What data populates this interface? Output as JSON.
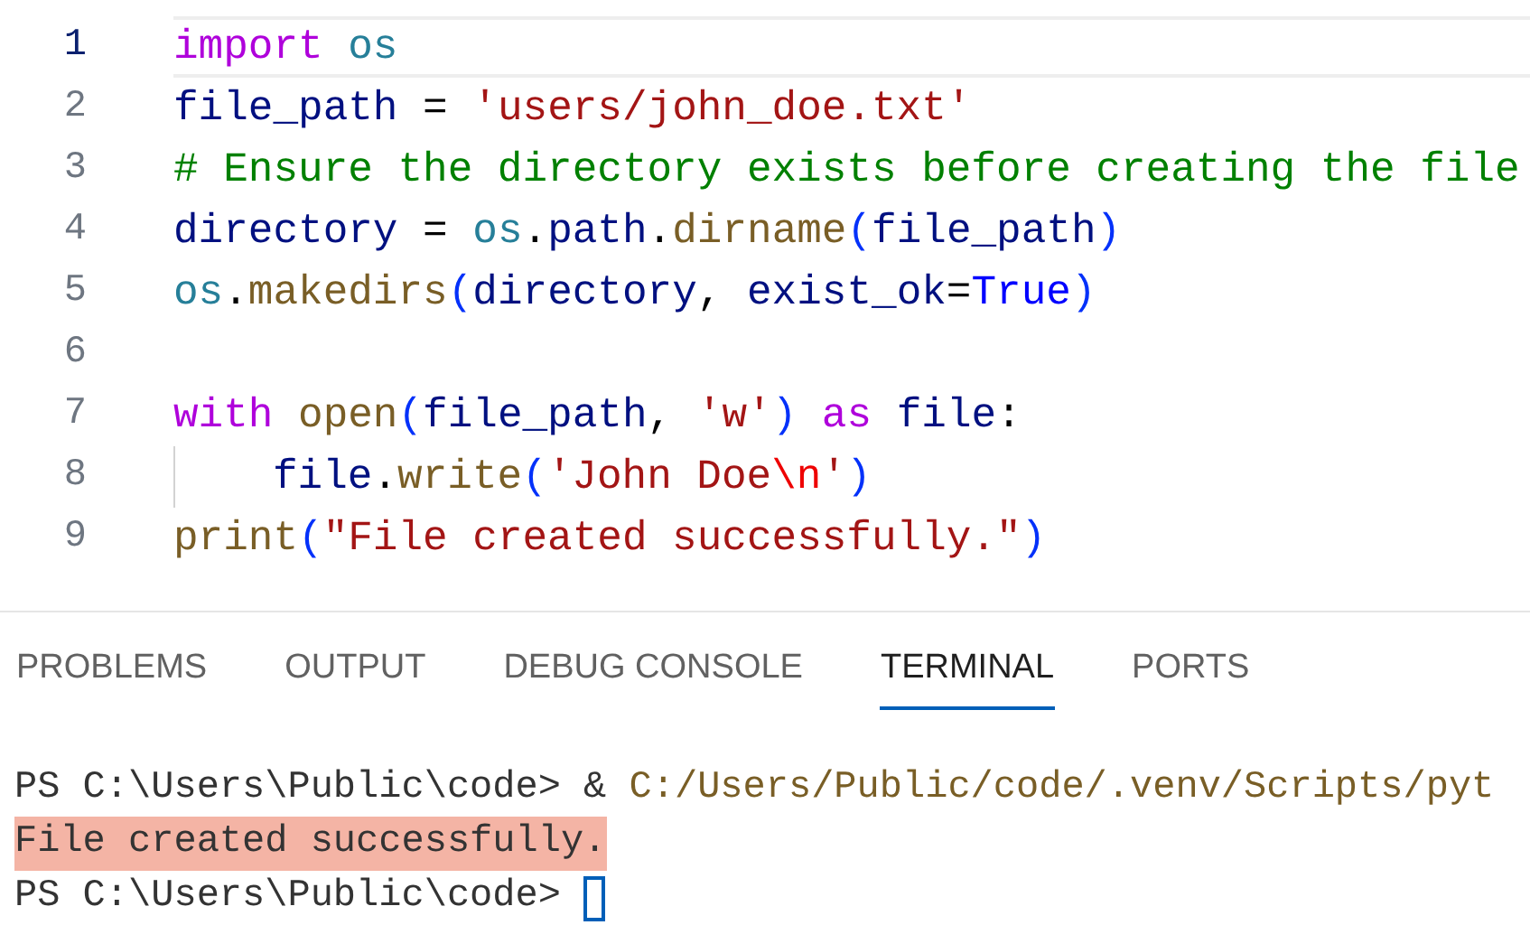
{
  "editor": {
    "lines": [
      {
        "number": "1",
        "current": true,
        "tokens": [
          {
            "kind": "keyword",
            "text": "import "
          },
          {
            "kind": "module",
            "text": "os"
          }
        ]
      },
      {
        "number": "2",
        "current": false,
        "tokens": [
          {
            "kind": "variable",
            "text": "file_path"
          },
          {
            "kind": "plain",
            "text": " = "
          },
          {
            "kind": "string",
            "text": "'users/john_doe.txt'"
          }
        ]
      },
      {
        "number": "3",
        "current": false,
        "tokens": [
          {
            "kind": "comment",
            "text": "# Ensure the directory exists before creating the file"
          }
        ]
      },
      {
        "number": "4",
        "current": false,
        "tokens": [
          {
            "kind": "variable",
            "text": "directory"
          },
          {
            "kind": "plain",
            "text": " = "
          },
          {
            "kind": "module",
            "text": "os"
          },
          {
            "kind": "plain",
            "text": "."
          },
          {
            "kind": "variable",
            "text": "path"
          },
          {
            "kind": "plain",
            "text": "."
          },
          {
            "kind": "function",
            "text": "dirname"
          },
          {
            "kind": "paren",
            "text": "("
          },
          {
            "kind": "variable",
            "text": "file_path"
          },
          {
            "kind": "paren",
            "text": ")"
          }
        ]
      },
      {
        "number": "5",
        "current": false,
        "tokens": [
          {
            "kind": "module",
            "text": "os"
          },
          {
            "kind": "plain",
            "text": "."
          },
          {
            "kind": "function",
            "text": "makedirs"
          },
          {
            "kind": "paren",
            "text": "("
          },
          {
            "kind": "variable",
            "text": "directory"
          },
          {
            "kind": "plain",
            "text": ", "
          },
          {
            "kind": "variable",
            "text": "exist_ok"
          },
          {
            "kind": "plain",
            "text": "="
          },
          {
            "kind": "constant",
            "text": "True"
          },
          {
            "kind": "paren",
            "text": ")"
          }
        ]
      },
      {
        "number": "6",
        "current": false
      },
      {
        "number": "7",
        "current": false,
        "tokens": [
          {
            "kind": "keyword",
            "text": "with "
          },
          {
            "kind": "function",
            "text": "open"
          },
          {
            "kind": "paren",
            "text": "("
          },
          {
            "kind": "variable",
            "text": "file_path"
          },
          {
            "kind": "plain",
            "text": ", "
          },
          {
            "kind": "string",
            "text": "'w'"
          },
          {
            "kind": "paren",
            "text": ") "
          },
          {
            "kind": "keyword",
            "text": "as "
          },
          {
            "kind": "variable",
            "text": "file"
          },
          {
            "kind": "plain",
            "text": ":"
          }
        ]
      },
      {
        "number": "8",
        "current": false,
        "indent_guide": true,
        "tokens": [
          {
            "kind": "variable",
            "text": "file"
          },
          {
            "kind": "plain",
            "text": "."
          },
          {
            "kind": "function",
            "text": "write"
          },
          {
            "kind": "paren",
            "text": "("
          },
          {
            "kind": "string",
            "text": "'John Doe"
          },
          {
            "kind": "escape",
            "text": "\\n"
          },
          {
            "kind": "string",
            "text": "'"
          },
          {
            "kind": "paren",
            "text": ")"
          }
        ]
      },
      {
        "number": "9",
        "current": false,
        "tokens": [
          {
            "kind": "function",
            "text": "print"
          },
          {
            "kind": "paren",
            "text": "("
          },
          {
            "kind": "string",
            "text": "\"File created successfully.\""
          },
          {
            "kind": "paren",
            "text": ")"
          }
        ]
      }
    ]
  },
  "panel": {
    "tabs": [
      {
        "label": "PROBLEMS",
        "selected": false
      },
      {
        "label": "OUTPUT",
        "selected": false
      },
      {
        "label": "DEBUG CONSOLE",
        "selected": false
      },
      {
        "label": "TERMINAL",
        "selected": true
      },
      {
        "label": "PORTS",
        "selected": false
      }
    ],
    "terminal": {
      "lines": [
        {
          "highlighted": false,
          "cursor": false,
          "segments": [
            {
              "kind": "prompt",
              "text": "PS C:\\Users\\Public\\code> & "
            },
            {
              "kind": "path",
              "text": "C:/Users/Public/code/.venv/Scripts/pyt"
            }
          ]
        },
        {
          "highlighted": true,
          "cursor": false,
          "segments": [
            {
              "kind": "output",
              "text": "File created successfully."
            }
          ]
        },
        {
          "highlighted": false,
          "cursor": true,
          "segments": [
            {
              "kind": "prompt",
              "text": "PS C:\\Users\\Public\\code> "
            }
          ]
        }
      ]
    }
  }
}
